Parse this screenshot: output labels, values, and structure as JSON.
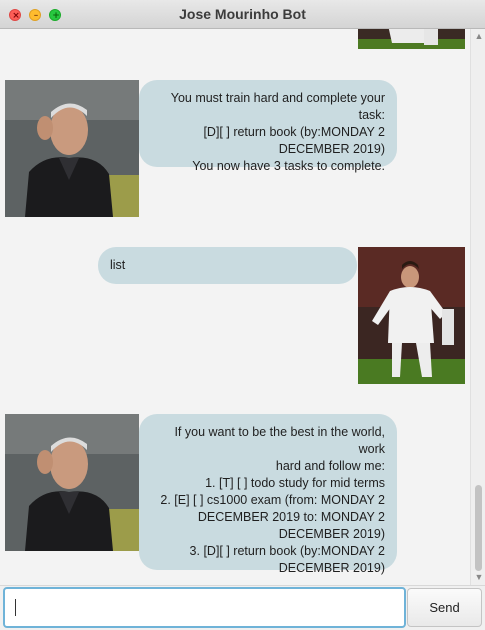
{
  "window": {
    "title": "Jose Mourinho Bot"
  },
  "window_controls": {
    "close_glyph": "×",
    "minimize_glyph": "–",
    "maximize_glyph": "+"
  },
  "messages": [
    {
      "sender": "user",
      "avatar": "ronaldo-avatar",
      "text": ""
    },
    {
      "sender": "bot",
      "avatar": "mourinho-avatar",
      "lines": [
        "You must train hard and complete your task:",
        "[D][ ] return book (by:MONDAY 2",
        "DECEMBER 2019)",
        "You now have 3 tasks to complete."
      ]
    },
    {
      "sender": "user",
      "avatar": "ronaldo-avatar",
      "lines": [
        "list"
      ]
    },
    {
      "sender": "bot",
      "avatar": "mourinho-avatar",
      "lines": [
        "If you want to be the best in the world, work",
        "hard and follow me:",
        "1. [T] [ ] todo study for mid terms",
        "2. [E] [ ] cs1000 exam  (from: MONDAY 2",
        "DECEMBER 2019  to: MONDAY 2",
        "DECEMBER 2019)",
        "3. [D][ ] return book (by:MONDAY 2",
        "DECEMBER 2019)"
      ]
    }
  ],
  "input": {
    "value": "",
    "placeholder": ""
  },
  "send_button": {
    "label": "Send"
  },
  "colors": {
    "bubble": "#c9dbe0",
    "input_focus": "#6fb3d8",
    "background": "#f3f3f3"
  }
}
